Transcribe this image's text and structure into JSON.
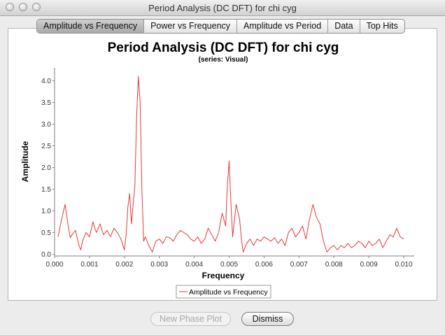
{
  "window": {
    "title": "Period Analysis (DC DFT) for chi cyg"
  },
  "tabs": [
    {
      "label": "Amplitude vs Frequency",
      "active": true
    },
    {
      "label": "Power vs Frequency",
      "active": false
    },
    {
      "label": "Amplitude vs Period",
      "active": false
    },
    {
      "label": "Data",
      "active": false
    },
    {
      "label": "Top Hits",
      "active": false
    }
  ],
  "buttons": {
    "new_phase_plot": "New Phase Plot",
    "dismiss": "Dismiss",
    "new_phase_plot_enabled": false
  },
  "colors": {
    "series": "#e23a3a",
    "axis": "#7f7f7f",
    "window_bg": "#ececec"
  },
  "chart_data": {
    "type": "line",
    "title": "Period Analysis (DC DFT) for chi cyg",
    "subtitle": "(series: Visual)",
    "xlabel": "Frequency",
    "ylabel": "Amplitude",
    "xlim": [
      0.0,
      0.0103
    ],
    "ylim": [
      -0.04,
      4.3
    ],
    "xticks": [
      "0.000",
      "0.001",
      "0.002",
      "0.003",
      "0.004",
      "0.005",
      "0.006",
      "0.007",
      "0.008",
      "0.009",
      "0.010"
    ],
    "yticks": [
      "0.0",
      "0.5",
      "1.0",
      "1.5",
      "2.0",
      "2.5",
      "3.0",
      "3.5",
      "4.0"
    ],
    "grid": false,
    "legend": "bottom-center",
    "series": [
      {
        "name": "Amplitude vs Frequency",
        "x": [
          0.0001,
          0.0002,
          0.0003,
          0.0004,
          0.00045,
          0.0005,
          0.0006,
          0.0007,
          0.00075,
          0.0008,
          0.0009,
          0.001,
          0.0011,
          0.00115,
          0.0012,
          0.0013,
          0.0014,
          0.0015,
          0.0016,
          0.0017,
          0.0018,
          0.0019,
          0.002,
          0.00205,
          0.0021,
          0.00215,
          0.0022,
          0.0023,
          0.00235,
          0.0024,
          0.00245,
          0.0025,
          0.00255,
          0.0026,
          0.0027,
          0.0028,
          0.0029,
          0.003,
          0.0031,
          0.0032,
          0.0033,
          0.0034,
          0.0035,
          0.0036,
          0.0037,
          0.0038,
          0.0039,
          0.004,
          0.0041,
          0.0042,
          0.0043,
          0.0044,
          0.0045,
          0.0046,
          0.0047,
          0.0048,
          0.0049,
          0.00495,
          0.005,
          0.00505,
          0.0051,
          0.0052,
          0.0053,
          0.00535,
          0.0054,
          0.0055,
          0.0056,
          0.0057,
          0.0058,
          0.0059,
          0.006,
          0.0061,
          0.0062,
          0.0063,
          0.0064,
          0.0065,
          0.0066,
          0.0067,
          0.0068,
          0.0069,
          0.007,
          0.0071,
          0.0072,
          0.0073,
          0.0074,
          0.0075,
          0.0076,
          0.0077,
          0.0078,
          0.0079,
          0.008,
          0.0081,
          0.0082,
          0.0083,
          0.0084,
          0.0085,
          0.0086,
          0.0087,
          0.0088,
          0.0089,
          0.009,
          0.0091,
          0.0092,
          0.0093,
          0.0094,
          0.0095,
          0.0096,
          0.0097,
          0.0098,
          0.0099,
          0.01
        ],
        "values": [
          0.4,
          0.8,
          1.15,
          0.6,
          0.38,
          0.45,
          0.55,
          0.2,
          0.1,
          0.3,
          0.5,
          0.4,
          0.75,
          0.6,
          0.5,
          0.7,
          0.45,
          0.55,
          0.4,
          0.6,
          0.5,
          0.35,
          0.1,
          0.45,
          1.1,
          1.4,
          0.7,
          1.6,
          3.2,
          4.1,
          3.5,
          1.5,
          0.3,
          0.4,
          0.2,
          0.05,
          0.3,
          0.35,
          0.25,
          0.4,
          0.38,
          0.3,
          0.45,
          0.55,
          0.5,
          0.45,
          0.35,
          0.3,
          0.4,
          0.25,
          0.35,
          0.6,
          0.45,
          0.3,
          0.5,
          0.95,
          0.65,
          1.6,
          2.15,
          1.2,
          0.4,
          1.15,
          0.8,
          0.35,
          0.05,
          0.25,
          0.35,
          0.2,
          0.35,
          0.3,
          0.4,
          0.35,
          0.3,
          0.38,
          0.25,
          0.35,
          0.2,
          0.5,
          0.6,
          0.4,
          0.5,
          0.65,
          0.35,
          0.8,
          1.15,
          0.85,
          0.7,
          0.3,
          0.05,
          0.15,
          0.2,
          0.1,
          0.2,
          0.15,
          0.25,
          0.15,
          0.2,
          0.3,
          0.25,
          0.15,
          0.3,
          0.2,
          0.25,
          0.35,
          0.15,
          0.3,
          0.45,
          0.4,
          0.6,
          0.4,
          0.35
        ]
      }
    ]
  }
}
